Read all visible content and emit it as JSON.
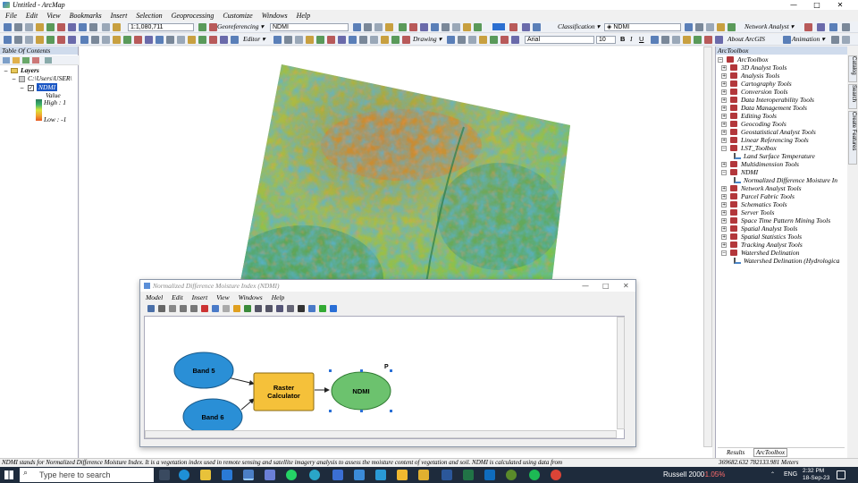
{
  "window": {
    "title": "Untitled - ArcMap",
    "minimize": "—",
    "maximize": "□",
    "close": "✕"
  },
  "menubar": [
    "File",
    "Edit",
    "View",
    "Bookmarks",
    "Insert",
    "Selection",
    "Geoprocessing",
    "Customize",
    "Windows",
    "Help"
  ],
  "toolbar1": {
    "scale_value": "1:1,080,711",
    "georeferencing_label": "Georeferencing ▾",
    "georef_layer": "NDMI",
    "classification_label": "Classification ▾",
    "classification_layer": "NDMI",
    "network_analyst_label": "Network Analyst ▾"
  },
  "toolbar2": {
    "editor_label": "Editor ▾",
    "drawing_label": "Drawing ▾",
    "font_name": "Arial",
    "font_size": "10",
    "bold": "B",
    "italic": "I",
    "underline": "U",
    "about_label": "About ArcGIS",
    "animation_label": "Animation ▾"
  },
  "toc": {
    "title": "Table Of Contents",
    "layers": "Layers",
    "path": "C:\\Users\\USER\\",
    "layer_name": "NDMI",
    "value_label": "Value",
    "high_label": "High : 1",
    "low_label": "Low : -1"
  },
  "arctoolbox": {
    "title": "ArcToolbox",
    "root": "ArcToolbox",
    "items": [
      {
        "label": "3D Analyst Tools",
        "kind": "toolbox",
        "exp": "+"
      },
      {
        "label": "Analysis Tools",
        "kind": "toolbox",
        "exp": "+"
      },
      {
        "label": "Cartography Tools",
        "kind": "toolbox",
        "exp": "+"
      },
      {
        "label": "Conversion Tools",
        "kind": "toolbox",
        "exp": "+"
      },
      {
        "label": "Data Interoperability Tools",
        "kind": "toolbox",
        "exp": "+"
      },
      {
        "label": "Data Management Tools",
        "kind": "toolbox",
        "exp": "+"
      },
      {
        "label": "Editing Tools",
        "kind": "toolbox",
        "exp": "+"
      },
      {
        "label": "Geocoding Tools",
        "kind": "toolbox",
        "exp": "+"
      },
      {
        "label": "Geostatistical Analyst Tools",
        "kind": "toolbox",
        "exp": "+"
      },
      {
        "label": "Linear Referencing Tools",
        "kind": "toolbox",
        "exp": "+"
      },
      {
        "label": "LST_Toolbox",
        "kind": "toolbox",
        "exp": "−"
      },
      {
        "label": "Land Surface Temperature",
        "kind": "tool",
        "exp": ""
      },
      {
        "label": "Multidimension Tools",
        "kind": "toolbox",
        "exp": "+"
      },
      {
        "label": "NDMI",
        "kind": "toolbox",
        "exp": "−"
      },
      {
        "label": "Normalized Difference Moisture In",
        "kind": "tool",
        "exp": ""
      },
      {
        "label": "Network Analyst Tools",
        "kind": "toolbox",
        "exp": "+"
      },
      {
        "label": "Parcel Fabric Tools",
        "kind": "toolbox",
        "exp": "+"
      },
      {
        "label": "Schematics Tools",
        "kind": "toolbox",
        "exp": "+"
      },
      {
        "label": "Server Tools",
        "kind": "toolbox",
        "exp": "+"
      },
      {
        "label": "Space Time Pattern Mining Tools",
        "kind": "toolbox",
        "exp": "+"
      },
      {
        "label": "Spatial Analyst Tools",
        "kind": "toolbox",
        "exp": "+"
      },
      {
        "label": "Spatial Statistics Tools",
        "kind": "toolbox",
        "exp": "+"
      },
      {
        "label": "Tracking Analyst Tools",
        "kind": "toolbox",
        "exp": "+"
      },
      {
        "label": "Watershed Delination",
        "kind": "toolbox",
        "exp": "−"
      },
      {
        "label": "Watershed Delination (Hydrologica",
        "kind": "tool",
        "exp": ""
      }
    ],
    "tab_results": "Results",
    "tab_arctoolbox": "ArcToolbox",
    "side_tabs": [
      "Catalog",
      "Search",
      "Create Features"
    ]
  },
  "model_builder": {
    "title": "Normalized Difference Moisture Index (NDMI)",
    "menu": [
      "Model",
      "Edit",
      "Insert",
      "View",
      "Windows",
      "Help"
    ],
    "band5": "Band 5",
    "band6": "Band 6",
    "raster_calc_line1": "Raster",
    "raster_calc_line2": "Calculator",
    "ndmi": "NDMI",
    "p_marker": "P"
  },
  "status": {
    "text": "NDMI stands for Normalized Difference Moisture Index. It is a vegetation index used in remote sensing and satellite imagery analysis to assess the moisture content of vegetation and soil. NDMI is calculated using data from",
    "coords": "369682.632  782133.981 Meters"
  },
  "taskbar": {
    "search_placeholder": "Type here to search",
    "stock_name": "Russell 2000",
    "stock_change": "-1.05%",
    "lang": "ENG",
    "time": "2:32 PM",
    "date": "18-Sep-23"
  },
  "colors": {
    "toolbox_red": "#b3373b",
    "ellipse_blue": "#2a8fd6",
    "ellipse_green": "#6cc26e",
    "calc_yellow": "#f5c13a",
    "taskbar_bg": "#1e2b3c"
  }
}
